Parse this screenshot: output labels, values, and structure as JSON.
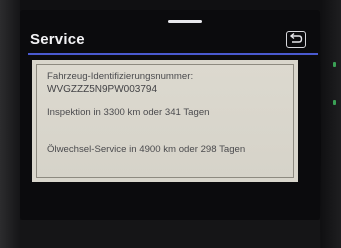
{
  "header": {
    "title": "Service",
    "back_icon": "back-arrow-icon"
  },
  "service_info": {
    "vin_label": "Fahrzeug-Identifizierungsnummer:",
    "vin_value": "WVGZZZ5N9PW003794",
    "inspection": "Inspektion in 3300 km oder 341 Tagen",
    "oil_service": "Ölwechsel-Service in 4900 km oder 298 Tagen"
  },
  "colors": {
    "header_line": "#4a5ad0",
    "panel_background": "#d9d6cc",
    "screen_background": "#0b0b0d",
    "accent": "#3aa055"
  }
}
